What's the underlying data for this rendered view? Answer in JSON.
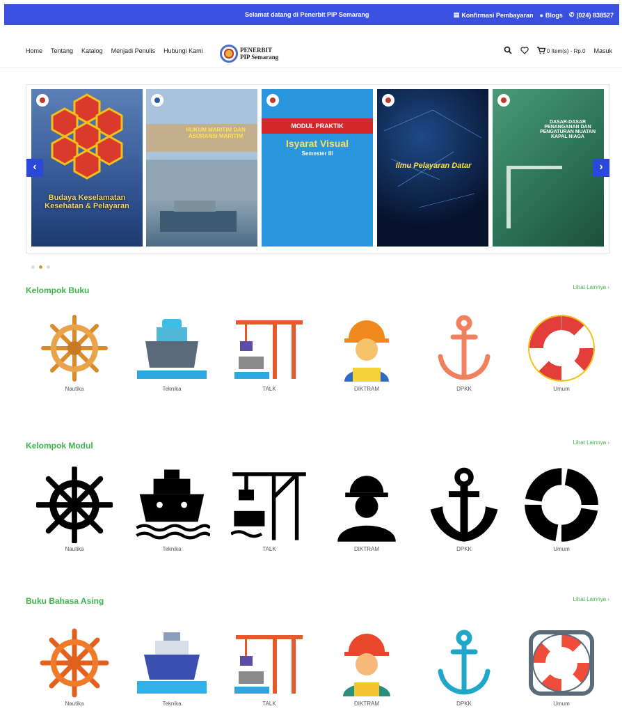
{
  "topbar": {
    "welcome": "Selamat datang di Penerbit PIP Semarang",
    "links": [
      "Konfirmasi Pembayaran",
      "Blogs",
      "(024) 838527"
    ]
  },
  "nav": {
    "menu": [
      "Home",
      "Tentang",
      "Katalog",
      "Menjadi Penulis",
      "Hubungi Kami"
    ],
    "logo_line1": "PENERBIT",
    "logo_line2": "PIP Semarang",
    "cart": "0 Item(s) - Rp.0",
    "login": "Masuk"
  },
  "slider": {
    "books": [
      {
        "title": "Budaya Keselamatan Kesehatan & Pelayaran"
      },
      {
        "title": "HUKUM MARITIM DAN ASURANSI MARITIM"
      },
      {
        "title": "MODUL PRAKTIK",
        "subtitle": "Isyarat Visual",
        "extra": "Semester III"
      },
      {
        "title": "Ilmu Pelayaran Datar"
      },
      {
        "title": "DASAR-DASAR PENANGANAN DAN PENGATURAN MUATAN KAPAL NIAGA"
      }
    ],
    "active_dot": 1
  },
  "sections": [
    {
      "title": "Kelompok Buku",
      "more": "Lihat Lainnya ›",
      "items": [
        "Nautika",
        "Teknika",
        "TALK",
        "DIKTRAM",
        "DPKK",
        "Umum"
      ]
    },
    {
      "title": "Kelompok Modul",
      "more": "Lihat Lainnya ›",
      "items": [
        "Nautika",
        "Teknika",
        "TALK",
        "DIKTRAM",
        "DPKK",
        "Umum"
      ]
    },
    {
      "title": "Buku Bahasa Asing",
      "more": "Lihat Lainnya ›",
      "items": [
        "Nautika",
        "Teknika",
        "TALK",
        "DIKTRAM",
        "DPKK",
        "Umum"
      ]
    }
  ],
  "colors": {
    "brand_blue": "#3b4fe0",
    "accent_green": "#3ab54a"
  }
}
